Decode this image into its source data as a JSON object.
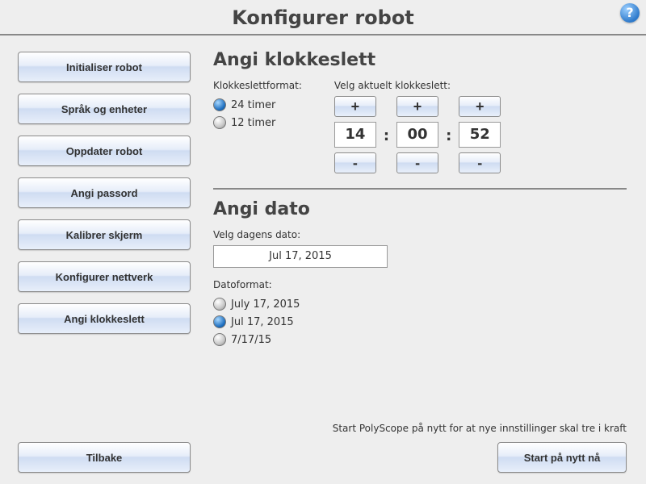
{
  "header": {
    "title": "Konfigurer robot"
  },
  "sidebar": {
    "items": [
      "Initialiser robot",
      "Språk og enheter",
      "Oppdater robot",
      "Angi passord",
      "Kalibrer skjerm",
      "Konfigurer nettverk",
      "Angi klokkeslett"
    ],
    "back": "Tilbake"
  },
  "time": {
    "section_title": "Angi klokkeslett",
    "format_label": "Klokkeslettformat:",
    "opt_24": "24 timer",
    "opt_12": "12 timer",
    "format_selected": "24",
    "pick_label": "Velg aktuelt klokkeslett:",
    "hh": "14",
    "mm": "00",
    "ss": "52",
    "plus": "+",
    "minus": "-"
  },
  "date": {
    "section_title": "Angi dato",
    "pick_label": "Velg dagens dato:",
    "value": "Jul 17, 2015",
    "format_label": "Datoformat:",
    "opt_long": "July 17, 2015",
    "opt_med": "Jul 17, 2015",
    "opt_short": "7/17/15",
    "format_selected": "med"
  },
  "footer": {
    "note": "Start PolyScope på nytt for at nye innstillinger skal tre i kraft",
    "restart": "Start på nytt nå"
  }
}
